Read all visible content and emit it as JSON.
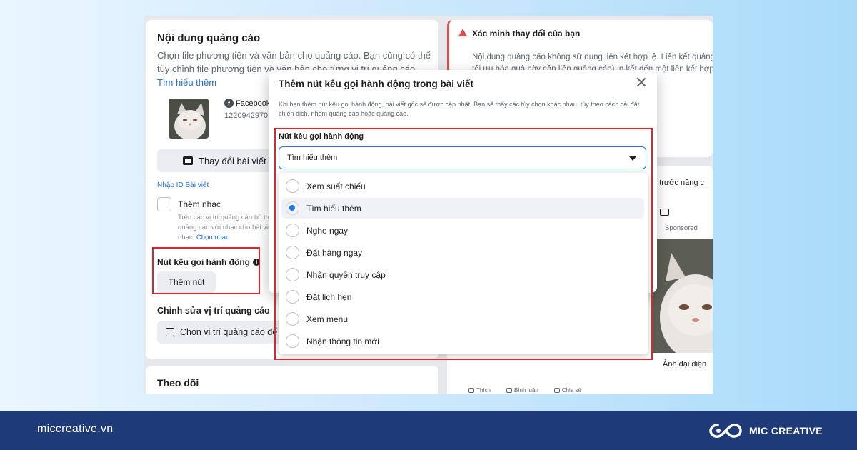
{
  "left_card": {
    "title": "Nội dung quảng cáo",
    "desc": "Chọn file phương tiện và văn bản cho quảng cáo. Bạn cũng có thể tùy chỉnh file phương tiện và văn bản cho từng vị trí quảng cáo.",
    "desc_link": "Tìm hiểu thêm",
    "page_name": "Facebook",
    "post_id": "1220942970",
    "change_post_label": "Thay đổi bài viết",
    "import_id_label": "Nhập ID Bài viết",
    "music_label": "Thêm nhạc",
    "music_desc": "Trên các vị trí quảng cáo hỗ trợ, quảng cáo với nhạc cho bài viết có nhạc.",
    "music_link": "Chọn nhạc",
    "cta_label": "Nút kêu gọi hành động",
    "add_button_label": "Thêm nút",
    "placement_title": "Chỉnh sửa vị trí quảng cáo",
    "placement_button_label": "Chọn vị trí quảng cáo để"
  },
  "follow_card": {
    "title": "Theo dõi"
  },
  "warning_card": {
    "title": "Xác minh thay đổi của bạn",
    "body": "Nội dung quảng cáo không sử dụng liên kết hợp lệ. Liên kết quảng cáo để tối ưu hóa quả này cần liên quảng cáo), n kết đến một liên kết hợp lệ."
  },
  "preview_card": {
    "advanced_preview": "n trước nâng c",
    "sponsored": "Sponsored",
    "avatar_label": "Ảnh đại diện",
    "actions": [
      "Thích",
      "Bình luận",
      "Chia sẻ"
    ]
  },
  "modal": {
    "title": "Thêm nút kêu gọi hành động trong bài viết",
    "desc": "Khi bạn thêm nút kêu gọi hành động, bài viết gốc sẽ được cập nhật. Bạn sẽ thấy các tùy chọn khác nhau, tùy theo cách cài đặt chiến dịch, nhóm quảng cáo hoặc quảng cáo.",
    "field_label": "Nút kêu gọi hành động",
    "selected_value": "Tìm hiểu thêm",
    "options": [
      "Xem suất chiếu",
      "Tìm hiểu thêm",
      "Nghe ngay",
      "Đặt hàng ngay",
      "Nhận quyền truy cập",
      "Đặt lịch hẹn",
      "Xem menu",
      "Nhận thông tin mới"
    ],
    "selected_index": 1
  },
  "footer": {
    "site": "miccreative.vn",
    "brand": "MIC CREATIVE"
  },
  "colors": {
    "accent": "#1877f2",
    "highlight": "#d9262f",
    "footer": "#1e3a79"
  }
}
